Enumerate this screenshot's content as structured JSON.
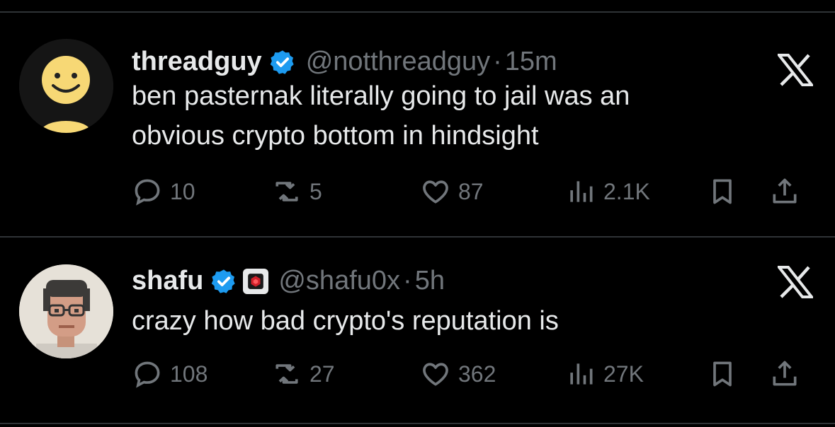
{
  "tweets": [
    {
      "name": "threadguy",
      "handle": "@notthreadguy",
      "separator": "·",
      "time": "15m",
      "text_lines": [
        "ben pasternak literally going to jail was an",
        "obvious crypto bottom in hindsight"
      ],
      "replies": "10",
      "reposts": "5",
      "likes": "87",
      "views": "2.1K",
      "avatar_icon": "smiley-face-avatar",
      "has_affiliation_badge": false
    },
    {
      "name": "shafu",
      "handle": "@shafu0x",
      "separator": "·",
      "time": "5h",
      "text_lines": [
        "crazy how bad crypto's reputation is"
      ],
      "replies": "108",
      "reposts": "27",
      "likes": "362",
      "views": "27K",
      "avatar_icon": "pixel-art-portrait-avatar",
      "has_affiliation_badge": true
    }
  ],
  "colors": {
    "background": "#000000",
    "primary_text": "#e7e9ea",
    "secondary_text": "#71767b",
    "verified_badge": "#1d9bf0",
    "divider": "#2f3336"
  }
}
